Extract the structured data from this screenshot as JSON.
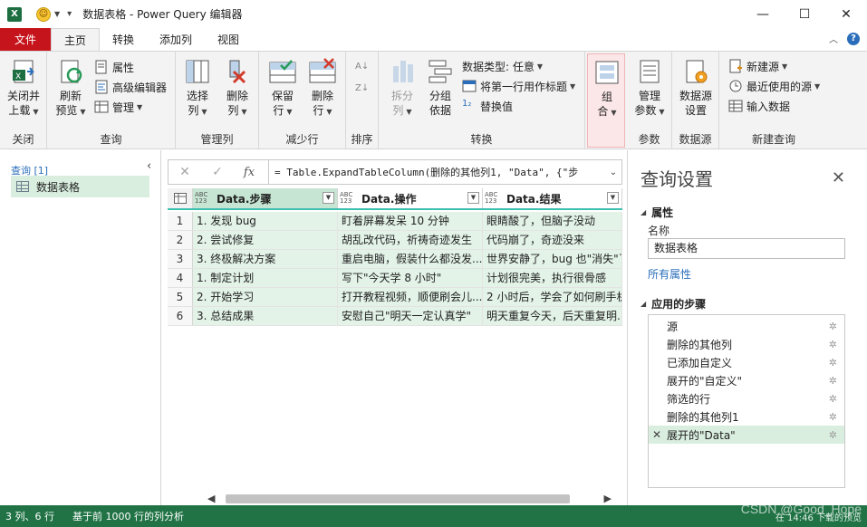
{
  "window": {
    "title": "数据表格 - Power Query 编辑器",
    "app_icon": "X",
    "quick_access_icon": "smiley-icon",
    "minimize": "—",
    "maximize": "☐",
    "close": "✕"
  },
  "tabs": [
    {
      "label": "文件"
    },
    {
      "label": "主页"
    },
    {
      "label": "转换"
    },
    {
      "label": "添加列"
    },
    {
      "label": "视图"
    }
  ],
  "help_label": "?",
  "ribbon": {
    "groups": {
      "close": {
        "label": "关闭",
        "btn_line1": "关闭并",
        "btn_line2": "上载"
      },
      "query": {
        "label": "查询",
        "refresh_line1": "刷新",
        "refresh_line2": "预览",
        "properties": "属性",
        "advanced_editor": "高级编辑器",
        "manage": "管理"
      },
      "manage_columns": {
        "label": "管理列",
        "choose_line1": "选择",
        "choose_line2": "列",
        "remove_line1": "删除",
        "remove_line2": "列"
      },
      "reduce_rows": {
        "label": "减少行",
        "keep_line1": "保留",
        "keep_line2": "行",
        "remove_line1": "删除",
        "remove_line2": "行"
      },
      "sort": {
        "label": "排序"
      },
      "transform": {
        "label": "转换",
        "split_line1": "拆分",
        "split_line2": "列",
        "group_line1": "分组",
        "group_line2": "依据",
        "data_type": "数据类型: 任意",
        "first_row_header": "将第一行用作标题",
        "replace_values": "替换值"
      },
      "combine": {
        "line1": "组",
        "line2": "合"
      },
      "parameters": {
        "label": "参数",
        "line1": "管理",
        "line2": "参数"
      },
      "data_source": {
        "label": "数据源",
        "line1": "数据源",
        "line2": "设置"
      },
      "new_query": {
        "label": "新建查询",
        "new_source": "新建源",
        "recent_sources": "最近使用的源",
        "enter_data": "输入数据"
      }
    }
  },
  "queries_pane": {
    "header": "查询 [1]",
    "items": [
      {
        "label": "数据表格"
      }
    ]
  },
  "formula_bar": {
    "cancel": "✕",
    "confirm": "✓",
    "fx": "fx",
    "formula": "= Table.ExpandTableColumn(删除的其他列1, \"Data\", {\"步"
  },
  "grid": {
    "columns": [
      {
        "type": "ABC\n123",
        "name": "Data.步骤"
      },
      {
        "type": "ABC\n123",
        "name": "Data.操作"
      },
      {
        "type": "ABC\n123",
        "name": "Data.结果"
      }
    ],
    "rows": [
      {
        "num": "1",
        "c1": "1. 发现 bug",
        "c2": "盯着屏幕发呆 10 分钟",
        "c3": "眼睛酸了，但脑子没动"
      },
      {
        "num": "2",
        "c1": "2. 尝试修复",
        "c2": "胡乱改代码，祈祷奇迹发生",
        "c3": "代码崩了，奇迹没来"
      },
      {
        "num": "3",
        "c1": "3. 终极解决方案",
        "c2": "重启电脑，假装什么都没发...",
        "c3": "世界安静了，bug 也\"消失\"了"
      },
      {
        "num": "4",
        "c1": "1. 制定计划",
        "c2": "写下\"今天学 8 小时\"",
        "c3": "计划很完美，执行很骨感"
      },
      {
        "num": "5",
        "c1": "2. 开始学习",
        "c2": "打开教程视频，顺便刷会儿...",
        "c3": "2 小时后，学会了如何刷手机"
      },
      {
        "num": "6",
        "c1": "3. 总结成果",
        "c2": "安慰自己\"明天一定认真学\"",
        "c3": "明天重复今天，后天重复明..."
      }
    ]
  },
  "settings_pane": {
    "title": "查询设置",
    "properties_header": "属性",
    "name_label": "名称",
    "name_value": "数据表格",
    "all_properties": "所有属性",
    "steps_header": "应用的步骤",
    "steps": [
      {
        "label": "源"
      },
      {
        "label": "删除的其他列"
      },
      {
        "label": "已添加自定义"
      },
      {
        "label": "展开的\"自定义\""
      },
      {
        "label": "筛选的行"
      },
      {
        "label": "删除的其他列1"
      },
      {
        "label": "展开的\"Data\""
      }
    ]
  },
  "status": {
    "left": "3 列、6 行",
    "middle": "基于前 1000 行的列分析",
    "right": "在 14:46 下载的预览"
  },
  "watermark": "CSDN @Good_Hope",
  "colors": {
    "file_tab": "#c6141c",
    "status_bar": "#217346",
    "selected_fill": "#d9eedf",
    "header_accent": "#3fbfb0",
    "link": "#2a6ebb"
  }
}
